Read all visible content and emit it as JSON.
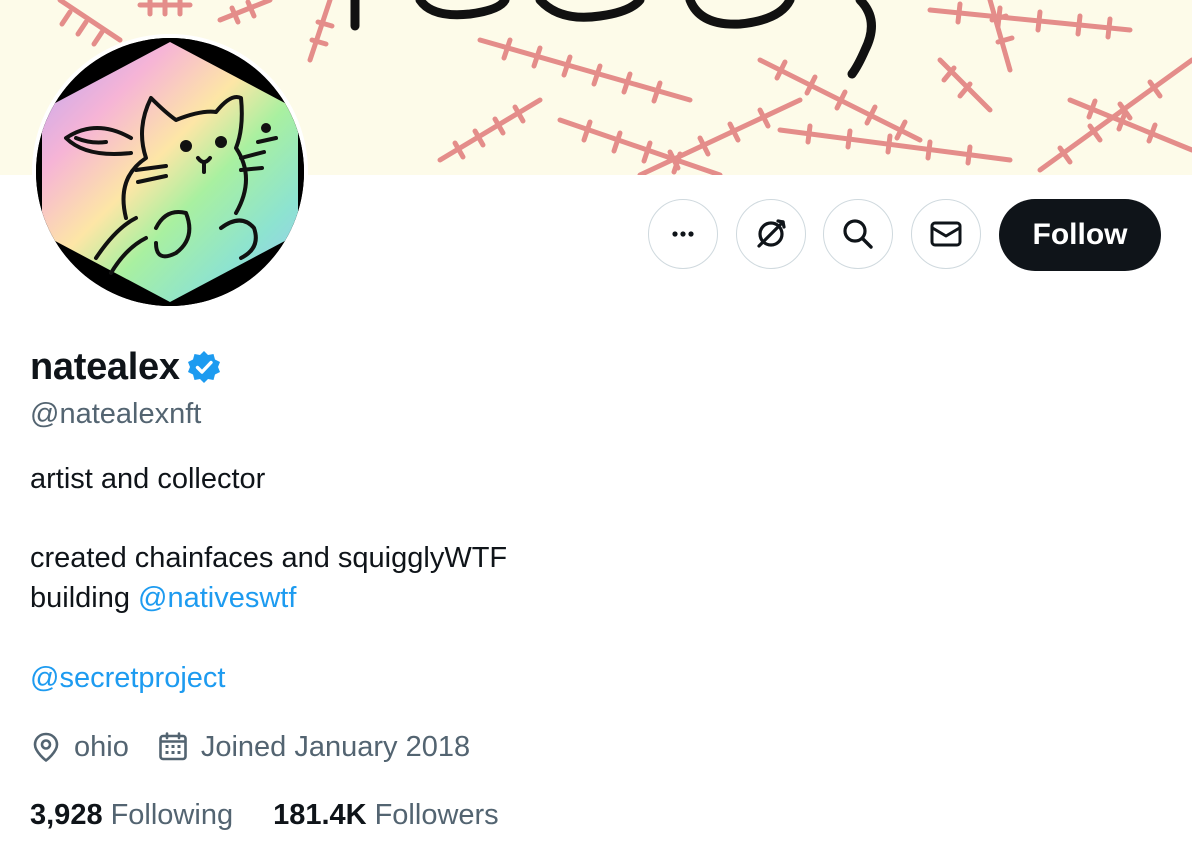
{
  "profile": {
    "display_name": "natealex",
    "handle": "@natealexnft",
    "verified": true
  },
  "actions": {
    "more_icon": "more-horizontal-icon",
    "subscribe_icon": "subscribe-circle-icon",
    "search_icon": "search-icon",
    "message_icon": "envelope-icon",
    "follow_label": "Follow"
  },
  "bio": {
    "line1": "artist and collector",
    "line2": "created chainfaces and squigglyWTF",
    "line3_prefix": "building ",
    "line3_mention": "@nativeswtf",
    "line4_mention": "@secretproject"
  },
  "meta": {
    "location_icon": "location-pin-icon",
    "location": "ohio",
    "joined_icon": "calendar-icon",
    "joined": "Joined January 2018"
  },
  "stats": {
    "following_count": "3,928",
    "following_label": "Following",
    "followers_count": "181.4K",
    "followers_label": "Followers"
  },
  "colors": {
    "accent": "#1d9bf0",
    "text_primary": "#0f1419",
    "text_secondary": "#536471",
    "follow_bg": "#0f1419",
    "banner_bg": "#fdfbe9",
    "banner_stitch": "#e57373"
  }
}
